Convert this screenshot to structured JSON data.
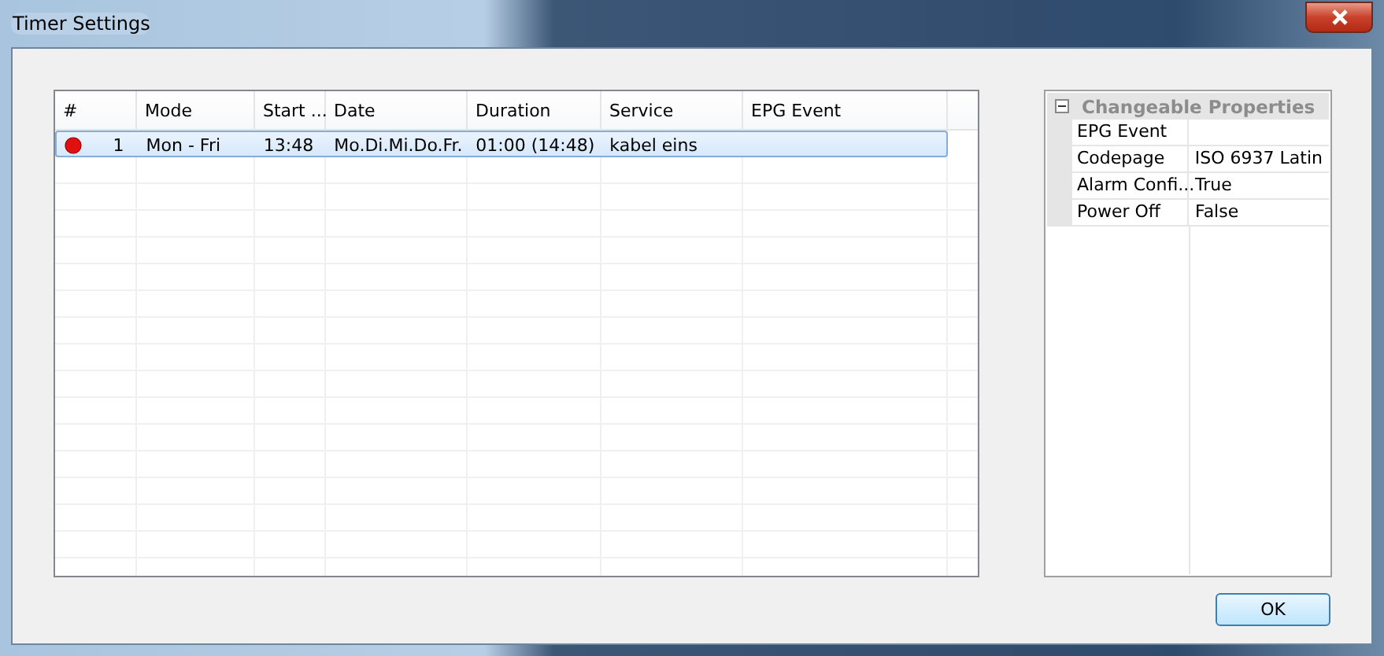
{
  "window": {
    "title": "Timer Settings"
  },
  "table": {
    "columns": [
      "#",
      "Mode",
      "Start ...",
      "Date",
      "Duration",
      "Service",
      "EPG Event"
    ],
    "rows": [
      {
        "selected": true,
        "cells": [
          "1",
          "Mon - Fri",
          "13:48",
          "Mo.Di.Mi.Do.Fr.",
          "01:00 (14:48)",
          "kabel eins",
          ""
        ]
      }
    ]
  },
  "properties": {
    "category": "Changeable Properties",
    "expanded": true,
    "items": [
      {
        "name": "EPG Event",
        "value": ""
      },
      {
        "name": "Codepage",
        "value": "ISO 6937 Latin"
      },
      {
        "name": "Alarm Confi...",
        "value": "True"
      },
      {
        "name": "Power Off",
        "value": "False"
      }
    ]
  },
  "buttons": [
    "OK"
  ]
}
